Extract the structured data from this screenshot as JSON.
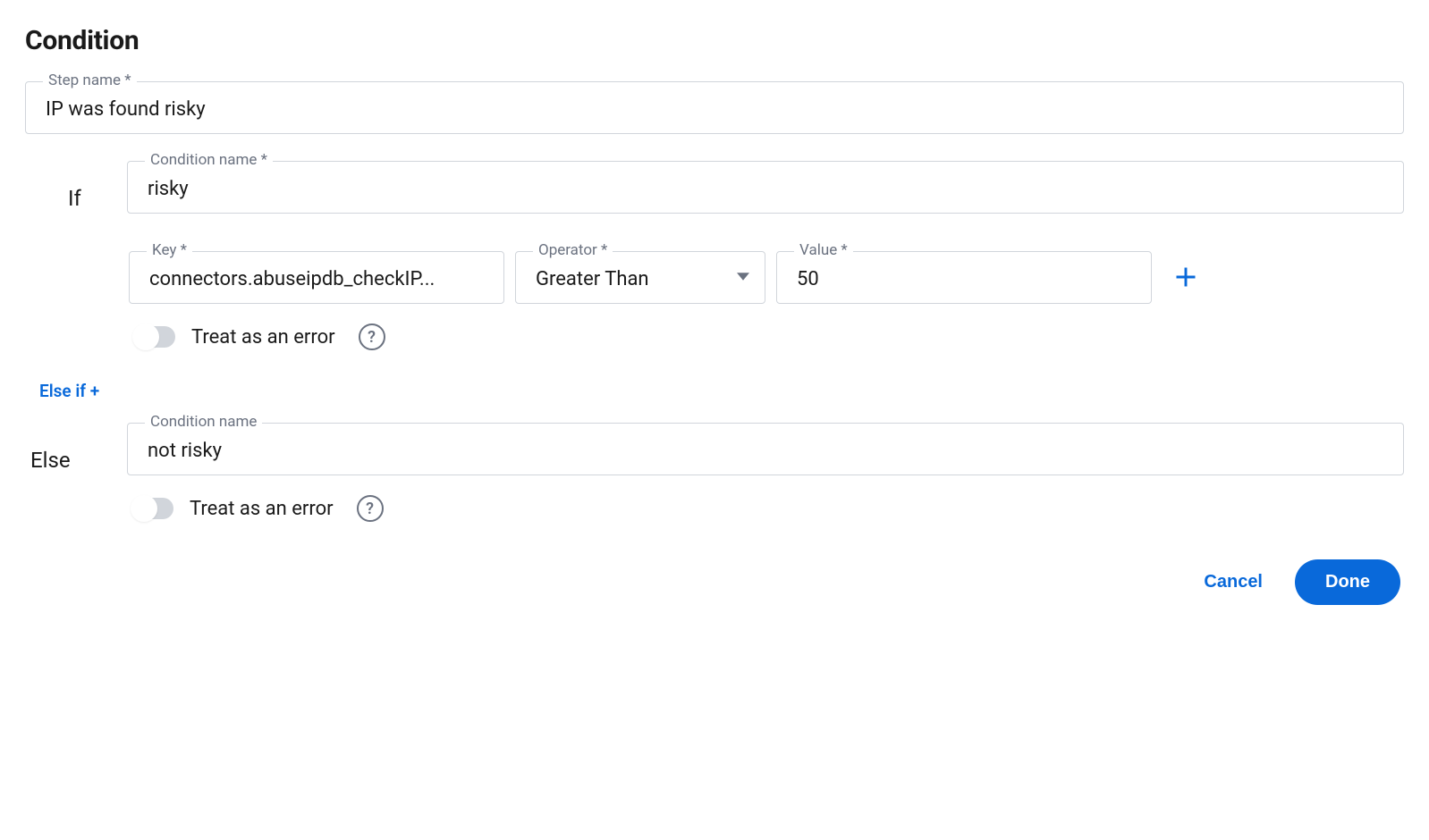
{
  "title": "Condition",
  "stepName": {
    "label": "Step name *",
    "value": "IP was found risky"
  },
  "ifBranch": {
    "label": "If",
    "conditionName": {
      "label": "Condition name *",
      "value": "risky"
    },
    "key": {
      "label": "Key *",
      "value": "connectors.abuseipdb_checkIP..."
    },
    "operator": {
      "label": "Operator *",
      "value": "Greater Than"
    },
    "valueField": {
      "label": "Value *",
      "value": "50"
    },
    "treatAsErrorLabel": "Treat as an error"
  },
  "elseIfLabel": "Else if +",
  "elseBranch": {
    "label": "Else",
    "conditionName": {
      "label": "Condition name",
      "value": "not risky"
    },
    "treatAsErrorLabel": "Treat as an error"
  },
  "footer": {
    "cancelLabel": "Cancel",
    "doneLabel": "Done"
  }
}
